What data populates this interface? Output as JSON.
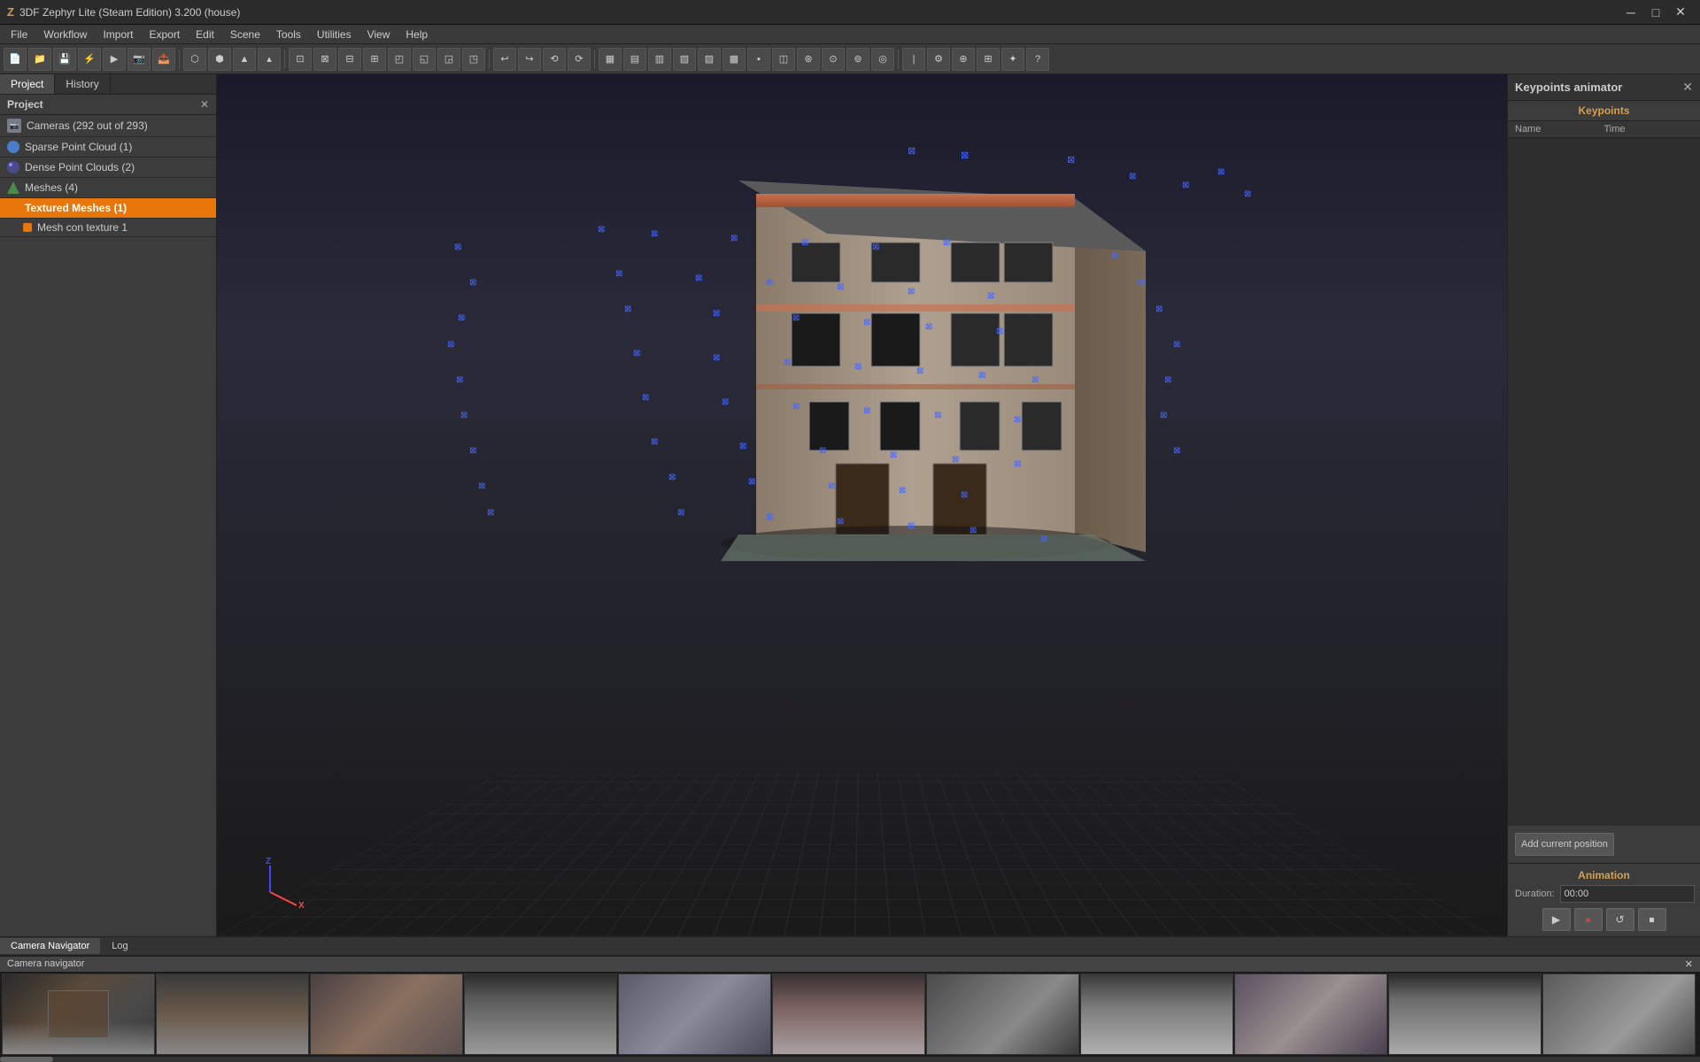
{
  "titlebar": {
    "icon": "Z",
    "title": "3DF Zephyr Lite (Steam Edition) 3.200 (house)",
    "minimize_label": "─",
    "maximize_label": "□",
    "close_label": "✕"
  },
  "menubar": {
    "items": [
      "File",
      "Workflow",
      "Import",
      "Export",
      "Edit",
      "Scene",
      "Tools",
      "Utilities",
      "View",
      "Help"
    ]
  },
  "toolbar": {
    "groups": [
      {
        "tools": [
          "⊕",
          "↺",
          "▦",
          "◫",
          "⊛",
          "⚙",
          "▷",
          "◈"
        ]
      },
      {
        "tools": [
          "⬡",
          "⬢",
          "⬣",
          "⬤",
          "▲",
          "▴"
        ]
      },
      {
        "tools": [
          "⊟",
          "⊞",
          "⊠",
          "⊡",
          "◰",
          "◱",
          "◲",
          "◳"
        ]
      },
      {
        "tools": [
          "⊗",
          "⊕",
          "⊖",
          "◉",
          "⊘",
          "⊙",
          "◎",
          "⊚",
          "⊛",
          "⊜",
          "⊝",
          "⊞",
          "⊟"
        ]
      },
      {
        "tools": [
          "↩",
          "↪",
          "⟲",
          "⟳"
        ]
      },
      {
        "tools": [
          "⬡",
          "⬢",
          "⬣",
          "⬤",
          "▤",
          "▥",
          "▦",
          "▧",
          "▨",
          "▩",
          "▪"
        ]
      },
      {
        "tools": [
          "|",
          "⚙",
          "⊕",
          "⊞",
          "✦",
          "?"
        ]
      },
      {
        "tools": [
          "▾",
          "↑"
        ]
      }
    ]
  },
  "left_panel": {
    "tabs": [
      "Project",
      "History"
    ],
    "project_title": "Project",
    "items": [
      {
        "label": "Cameras (292 out of 293)",
        "icon": "cameras",
        "selected": false
      },
      {
        "label": "Sparse Point Cloud (1)",
        "icon": "sparse",
        "selected": false
      },
      {
        "label": "Dense Point Clouds (2)",
        "icon": "dense",
        "selected": false
      },
      {
        "label": "Meshes (4)",
        "icon": "mesh",
        "selected": false
      },
      {
        "label": "Textured Meshes (1)",
        "icon": "textured",
        "selected": true
      }
    ],
    "sub_items": [
      {
        "label": "Mesh con texture 1",
        "icon": "orange-dot"
      }
    ]
  },
  "viewport": {
    "axis_z": "Z",
    "axis_x": "X"
  },
  "right_panel": {
    "title": "Keypoints animator",
    "keypoints_section": "Keypoints",
    "col_name": "Name",
    "col_time": "Time",
    "add_position_btn": "Add current position",
    "animation_section": "Animation",
    "duration_label": "Duration:",
    "duration_value": "00:00",
    "anim_play": "▶",
    "anim_record": "●",
    "anim_reset": "↺",
    "anim_end": "⏹"
  },
  "bottom_tabs": [
    "Camera Navigator",
    "Log"
  ],
  "camera_navigator": {
    "title": "Camera navigator",
    "close": "✕"
  },
  "camera_thumbs": [
    {
      "id": 1,
      "class": "thumb-1"
    },
    {
      "id": 2,
      "class": "thumb-2"
    },
    {
      "id": 3,
      "class": "thumb-3"
    },
    {
      "id": 4,
      "class": "thumb-4"
    },
    {
      "id": 5,
      "class": "thumb-5"
    },
    {
      "id": 6,
      "class": "thumb-6"
    },
    {
      "id": 7,
      "class": "thumb-7"
    },
    {
      "id": 8,
      "class": "thumb-8"
    },
    {
      "id": 9,
      "class": "thumb-9"
    },
    {
      "id": 10,
      "class": "thumb-10"
    },
    {
      "id": 11,
      "class": "thumb-11"
    }
  ],
  "colors": {
    "accent_orange": "#e8760a",
    "accent_blue": "#4466ff",
    "bg_dark": "#2a2a2a",
    "bg_panel": "#3c3c3c"
  }
}
